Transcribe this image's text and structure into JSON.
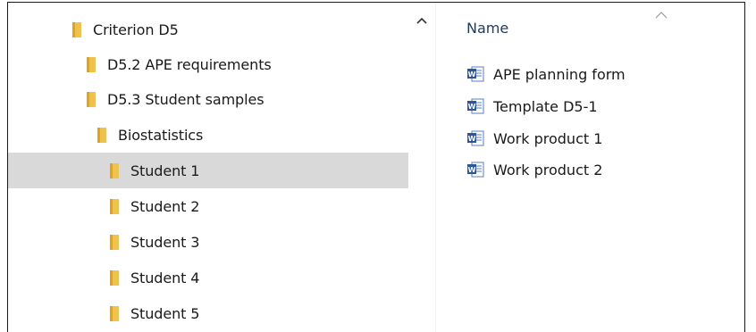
{
  "navigation_pane": {
    "items": [
      {
        "label": "Criterion D5",
        "indent": 0,
        "selected": false,
        "icon": "folder-icon"
      },
      {
        "label": "D5.2 APE requirements",
        "indent": 1,
        "selected": false,
        "icon": "folder-icon"
      },
      {
        "label": "D5.3 Student samples",
        "indent": 1,
        "selected": false,
        "icon": "folder-icon"
      },
      {
        "label": "Biostatistics",
        "indent": 2,
        "selected": false,
        "icon": "folder-icon"
      },
      {
        "label": "Student 1",
        "indent": 3,
        "selected": true,
        "icon": "folder-icon"
      },
      {
        "label": "Student 2",
        "indent": 3,
        "selected": false,
        "icon": "folder-icon"
      },
      {
        "label": "Student 3",
        "indent": 3,
        "selected": false,
        "icon": "folder-icon"
      },
      {
        "label": "Student 4",
        "indent": 3,
        "selected": false,
        "icon": "folder-icon"
      },
      {
        "label": "Student 5",
        "indent": 3,
        "selected": false,
        "icon": "folder-icon"
      }
    ]
  },
  "file_list": {
    "column_header": "Name",
    "files": [
      {
        "name": "APE planning form",
        "icon": "word-document-icon"
      },
      {
        "name": "Template D5-1",
        "icon": "word-document-icon"
      },
      {
        "name": "Work product 1",
        "icon": "word-document-icon"
      },
      {
        "name": "Work product 2",
        "icon": "word-document-icon"
      }
    ]
  },
  "colors": {
    "folder": "#f0c24b",
    "folder_dark": "#dba32a",
    "selection": "#d9d9d9",
    "word_blue": "#2b579a",
    "header_text": "#1e3a5f"
  }
}
